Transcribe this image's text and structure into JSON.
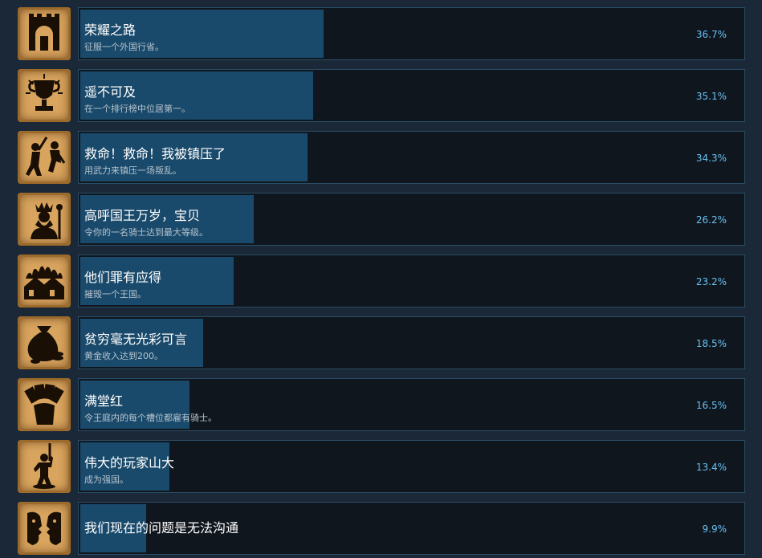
{
  "colors": {
    "background": "#1b2838",
    "bar_fill": "#1a4a6b",
    "bar_border": "#2b4e67",
    "percent_text": "#66c0f4",
    "icon_parchment": "#d8a45e"
  },
  "achievements": [
    {
      "title": "荣耀之路",
      "desc": "征服一个外国行省。",
      "percent": "36.7%",
      "fill": 0.367,
      "icon": "castle-gate-icon"
    },
    {
      "title": "遥不可及",
      "desc": "在一个排行榜中位居第一。",
      "percent": "35.1%",
      "fill": 0.351,
      "icon": "trophy-icon"
    },
    {
      "title": "救命！救命！我被镇压了",
      "desc": "用武力来镇压一场叛乱。",
      "percent": "34.3%",
      "fill": 0.343,
      "icon": "fighting-figures-icon"
    },
    {
      "title": "高呼国王万岁，宝贝",
      "desc": "令你的一名骑士达到最大等级。",
      "percent": "26.2%",
      "fill": 0.262,
      "icon": "king-icon"
    },
    {
      "title": "他们罪有应得",
      "desc": "摧毁一个王国。",
      "percent": "23.2%",
      "fill": 0.232,
      "icon": "burning-house-icon"
    },
    {
      "title": "贫穷毫无光彩可言",
      "desc": "黄金收入达到200。",
      "percent": "18.5%",
      "fill": 0.185,
      "icon": "money-bag-icon"
    },
    {
      "title": "满堂红",
      "desc": "令王庭内的每个槽位都雇有骑士。",
      "percent": "16.5%",
      "fill": 0.165,
      "icon": "hand-of-cards-icon"
    },
    {
      "title": "伟大的玩家山大",
      "desc": "成为强国。",
      "percent": "13.4%",
      "fill": 0.134,
      "icon": "raised-sword-figure-icon"
    },
    {
      "title": "我们现在的问题是无法沟通",
      "desc": "",
      "percent": "9.9%",
      "fill": 0.099,
      "icon": "two-faces-icon"
    }
  ]
}
